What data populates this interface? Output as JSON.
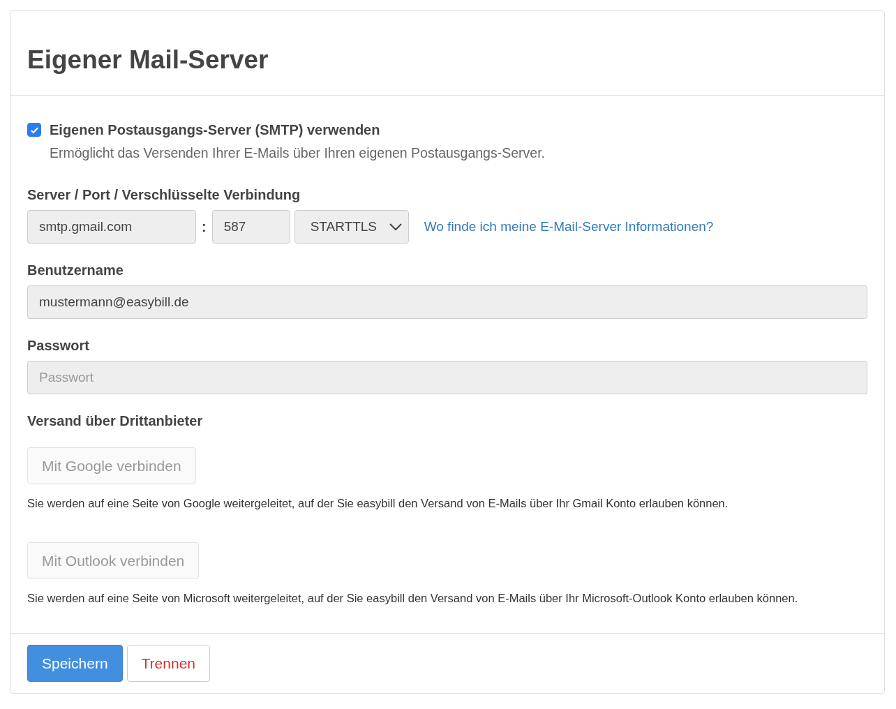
{
  "panel": {
    "title": "Eigener Mail-Server"
  },
  "smtp_option": {
    "label": "Eigenen Postausgangs-Server (SMTP) verwenden",
    "description": "Ermöglicht das Versenden Ihrer E-Mails über Ihren eigenen Postausgangs-Server.",
    "checked": true
  },
  "server": {
    "label": "Server / Port / Verschlüsselte Verbindung",
    "host": {
      "value": "smtp.gmail.com",
      "disabled": true
    },
    "separator": ":",
    "port": {
      "value": "587",
      "disabled": true
    },
    "encryption": {
      "value": "STARTTLS",
      "disabled": true
    },
    "help_link": "Wo finde ich meine E-Mail-Server Informationen?"
  },
  "username": {
    "label": "Benutzername",
    "value": "mustermann@easybill.de",
    "disabled": true
  },
  "password": {
    "label": "Passwort",
    "placeholder": "Passwort",
    "disabled": true
  },
  "third_party": {
    "label": "Versand über Drittanbieter",
    "providers": [
      {
        "button": "Mit Google verbinden",
        "disabled": true,
        "note": "Sie werden auf eine Seite von Google weitergeleitet, auf der Sie easybill den Versand von E-Mails über Ihr Gmail Konto erlauben können."
      },
      {
        "button": "Mit Outlook verbinden",
        "disabled": true,
        "note": "Sie werden auf eine Seite von Microsoft weitergeleitet, auf der Sie easybill den Versand von E-Mails über Ihr Microsoft-Outlook Konto erlauben können."
      }
    ]
  },
  "actions": [
    {
      "label": "Speichern",
      "kind": "primary"
    },
    {
      "label": "Trennen",
      "kind": "danger"
    }
  ]
}
